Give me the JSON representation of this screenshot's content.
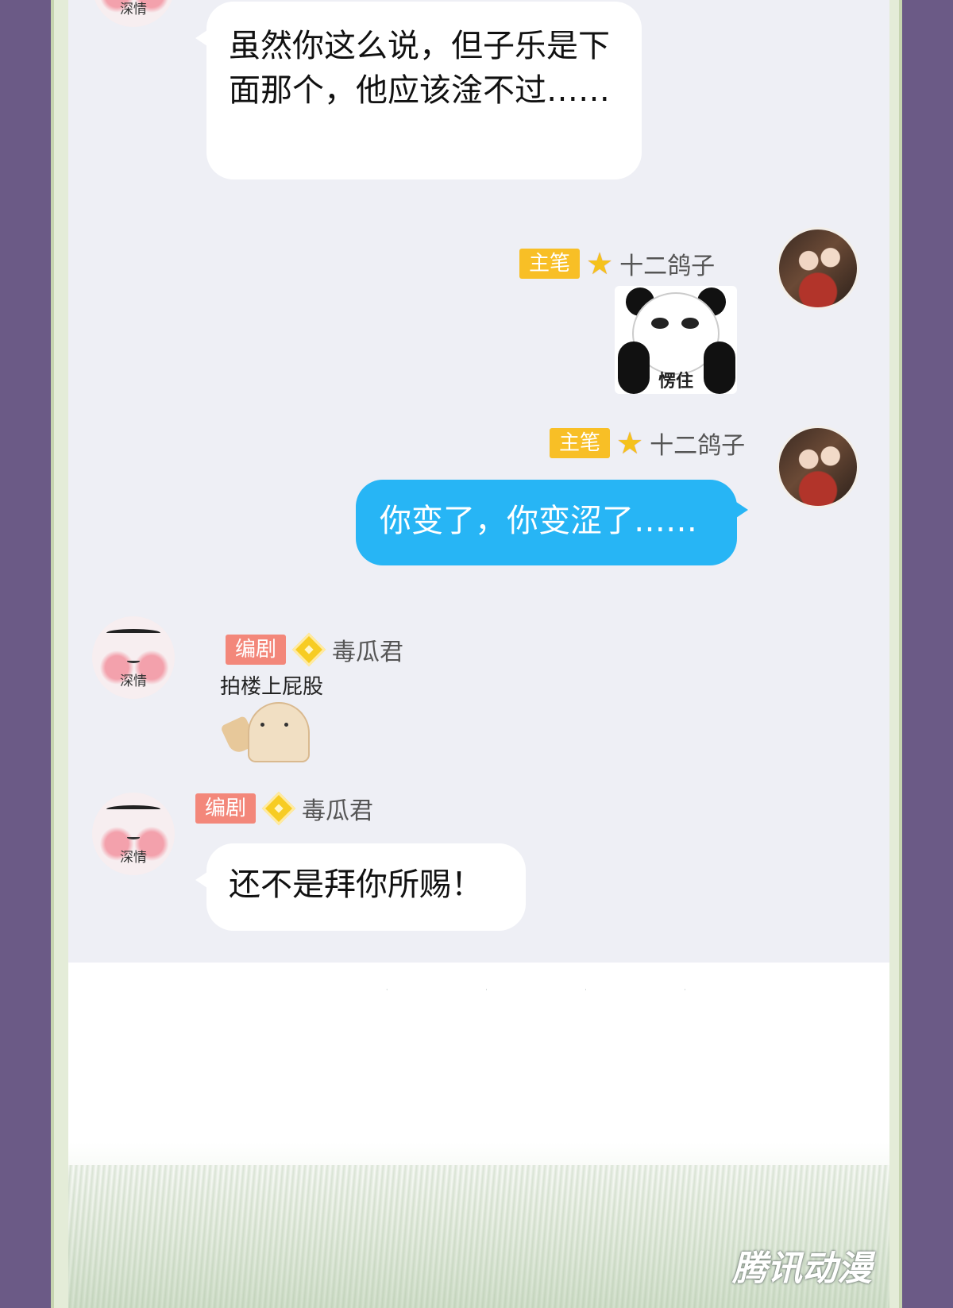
{
  "messages": {
    "m1": {
      "avatar_label": "深情",
      "text": "虽然你这么说，但子乐是下面那个，他应该淦不过……"
    },
    "m2": {
      "role_badge": "主笔",
      "username": "十二鸽子",
      "sticker_caption": "愣住"
    },
    "m3": {
      "role_badge": "主笔",
      "username": "十二鸽子",
      "text": "你变了，你变涩了……"
    },
    "m4": {
      "avatar_label": "深情",
      "role_badge": "编剧",
      "username": "毒瓜君",
      "sticker_caption": "拍楼上屁股"
    },
    "m5": {
      "avatar_label": "深情",
      "role_badge": "编剧",
      "username": "毒瓜君",
      "text": "还不是拜你所赐！"
    }
  },
  "footer": {
    "watermark": "腾讯动漫"
  },
  "colors": {
    "page_background": "#6b5a86",
    "chat_background": "#eeeff5",
    "bubble_blue": "#27b5f5",
    "badge_orange": "#f8bf26",
    "badge_pink": "#f3877a",
    "star_gold": "#f5c21b"
  },
  "icons": {
    "author_rank": "star-icon",
    "writer_rank": "diamond-icon"
  }
}
